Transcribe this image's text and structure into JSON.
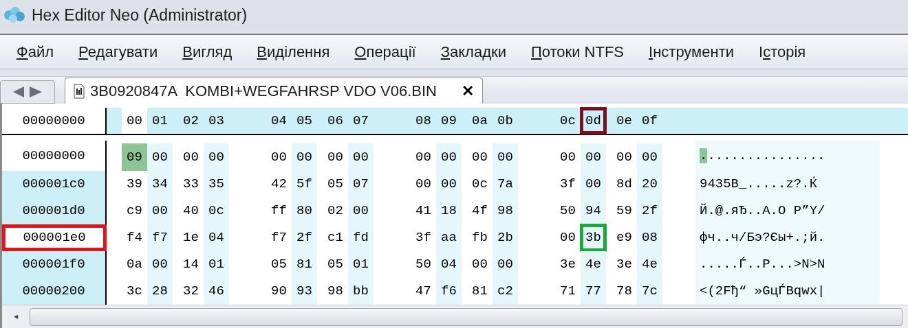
{
  "window": {
    "title": "Hex Editor Neo (Administrator)"
  },
  "menu": [
    {
      "key": "Ф",
      "post": "айл"
    },
    {
      "key": "Р",
      "post": "едагувати"
    },
    {
      "key": "В",
      "post": "игляд"
    },
    {
      "key": "В",
      "post": "иділення"
    },
    {
      "key": "О",
      "post": "перації"
    },
    {
      "key": "З",
      "post": "акладки"
    },
    {
      "key": "П",
      "post": "отоки NTFS"
    },
    {
      "key": "І",
      "post": "нструменти"
    },
    {
      "pre": "І",
      "key": "с",
      "post": "торія"
    }
  ],
  "tabs": [
    {
      "label": "3B0920847A  KOMBI+WEGFAHRSP VDO V06.BIN",
      "selected": true,
      "close": "✕"
    }
  ],
  "header": {
    "address": "00000000",
    "columns": [
      {
        "label": "00",
        "selected": true
      },
      {
        "label": "01",
        "selected": false
      },
      {
        "label": "02",
        "selected": false
      },
      {
        "label": "03",
        "selected": false
      },
      {
        "label": "04",
        "selected": false
      },
      {
        "label": "05",
        "selected": false
      },
      {
        "label": "06",
        "selected": false
      },
      {
        "label": "07",
        "selected": false
      },
      {
        "label": "08",
        "selected": false
      },
      {
        "label": "09",
        "selected": false
      },
      {
        "label": "0a",
        "selected": false
      },
      {
        "label": "0b",
        "selected": false
      },
      {
        "label": "0c",
        "selected": false
      },
      {
        "label": "0d",
        "selected": false,
        "color": "#7a0f1f"
      },
      {
        "label": "0e",
        "selected": false
      },
      {
        "label": "0f",
        "selected": false
      }
    ]
  },
  "cursor_row": {
    "address": "00000000",
    "bytes": [
      {
        "value": "09",
        "selected": true
      },
      {
        "value": "00",
        "selected": false
      },
      {
        "value": "00",
        "selected": false
      },
      {
        "value": "00",
        "selected": false
      },
      {
        "value": "00",
        "selected": false
      },
      {
        "value": "00",
        "selected": false
      },
      {
        "value": "00",
        "selected": false
      },
      {
        "value": "00",
        "selected": false
      },
      {
        "value": "00",
        "selected": false
      },
      {
        "value": "00",
        "selected": false
      },
      {
        "value": "00",
        "selected": false
      },
      {
        "value": "00",
        "selected": false
      },
      {
        "value": "00",
        "selected": false
      },
      {
        "value": "00",
        "selected": false
      },
      {
        "value": "00",
        "selected": false
      },
      {
        "value": "00",
        "selected": false
      }
    ],
    "text": "................",
    "text_cursor": true
  },
  "rows": [
    {
      "address": "000001c0",
      "bytes": [
        {
          "value": "39"
        },
        {
          "value": "34"
        },
        {
          "value": "33"
        },
        {
          "value": "35"
        },
        {
          "value": "42"
        },
        {
          "value": "5f"
        },
        {
          "value": "05"
        },
        {
          "value": "07"
        },
        {
          "value": "00"
        },
        {
          "value": "00"
        },
        {
          "value": "0c"
        },
        {
          "value": "7a"
        },
        {
          "value": "3f"
        },
        {
          "value": "00"
        },
        {
          "value": "8d"
        },
        {
          "value": "20"
        }
      ],
      "text": "9435B_.....z?.Ќ"
    },
    {
      "address": "000001d0",
      "bytes": [
        {
          "value": "c9"
        },
        {
          "value": "00"
        },
        {
          "value": "40"
        },
        {
          "value": "0c"
        },
        {
          "value": "ff"
        },
        {
          "value": "80"
        },
        {
          "value": "02"
        },
        {
          "value": "00"
        },
        {
          "value": "41"
        },
        {
          "value": "18"
        },
        {
          "value": "4f"
        },
        {
          "value": "98"
        },
        {
          "value": "50"
        },
        {
          "value": "94"
        },
        {
          "value": "59"
        },
        {
          "value": "2f"
        }
      ],
      "text": "Й.@.яЂ..A.O P”Y/"
    },
    {
      "address": "000001e0",
      "color": "#e3131b",
      "bytes": [
        {
          "value": "f4"
        },
        {
          "value": "f7"
        },
        {
          "value": "1e"
        },
        {
          "value": "04"
        },
        {
          "value": "f7"
        },
        {
          "value": "2f"
        },
        {
          "value": "c1"
        },
        {
          "value": "fd"
        },
        {
          "value": "3f"
        },
        {
          "value": "aa"
        },
        {
          "value": "fb"
        },
        {
          "value": "2b"
        },
        {
          "value": "00"
        },
        {
          "value": "3b",
          "color": "#1ea83c"
        },
        {
          "value": "e9"
        },
        {
          "value": "08"
        }
      ],
      "text": "фч..ч/Бэ?Єы+.;й."
    },
    {
      "address": "000001f0",
      "bytes": [
        {
          "value": "0a"
        },
        {
          "value": "00"
        },
        {
          "value": "14"
        },
        {
          "value": "01"
        },
        {
          "value": "05"
        },
        {
          "value": "81"
        },
        {
          "value": "05"
        },
        {
          "value": "01"
        },
        {
          "value": "50"
        },
        {
          "value": "04"
        },
        {
          "value": "00"
        },
        {
          "value": "00"
        },
        {
          "value": "3e"
        },
        {
          "value": "4e"
        },
        {
          "value": "3e"
        },
        {
          "value": "4e"
        }
      ],
      "text": ".....Ѓ..P...>N>N"
    },
    {
      "address": "00000200",
      "bytes": [
        {
          "value": "3c"
        },
        {
          "value": "28"
        },
        {
          "value": "32"
        },
        {
          "value": "46"
        },
        {
          "value": "90"
        },
        {
          "value": "93"
        },
        {
          "value": "98"
        },
        {
          "value": "bb"
        },
        {
          "value": "47"
        },
        {
          "value": "f6"
        },
        {
          "value": "81"
        },
        {
          "value": "c2"
        },
        {
          "value": "71"
        },
        {
          "value": "77"
        },
        {
          "value": "78"
        },
        {
          "value": "7c"
        }
      ],
      "text": "<(2Fђ“ »GцЃВqwx|"
    }
  ],
  "scrollbar": {
    "left_arrow": "◂"
  }
}
